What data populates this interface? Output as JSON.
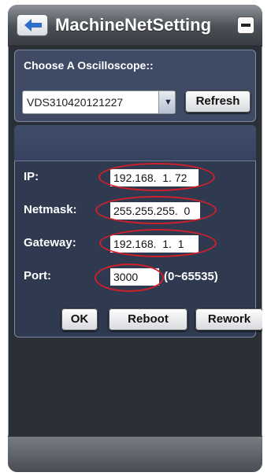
{
  "window": {
    "title": "MachineNetSetting",
    "back_icon": "back-arrow-icon",
    "minimize_icon": "minimize-icon"
  },
  "device_panel": {
    "label": "Choose A Oscilloscope::",
    "selected_device": "VDS310420121227",
    "dropdown_icon": "chevron-down-icon",
    "refresh_label": "Refresh"
  },
  "network": {
    "ip_label": "IP:",
    "ip_value": "192.168.  1. 72",
    "netmask_label": "Netmask:",
    "netmask_value": "255.255.255.  0",
    "gateway_label": "Gateway:",
    "gateway_value": "192.168.  1.  1",
    "port_label": "Port:",
    "port_value": "3000",
    "port_range": "(0~65535)"
  },
  "actions": {
    "ok_label": "OK",
    "reboot_label": "Reboot",
    "rework_label": "Rework"
  },
  "colors": {
    "annotation_ring": "#d0202a",
    "panel": "#3f4b64",
    "frame": "#2b2f36"
  }
}
